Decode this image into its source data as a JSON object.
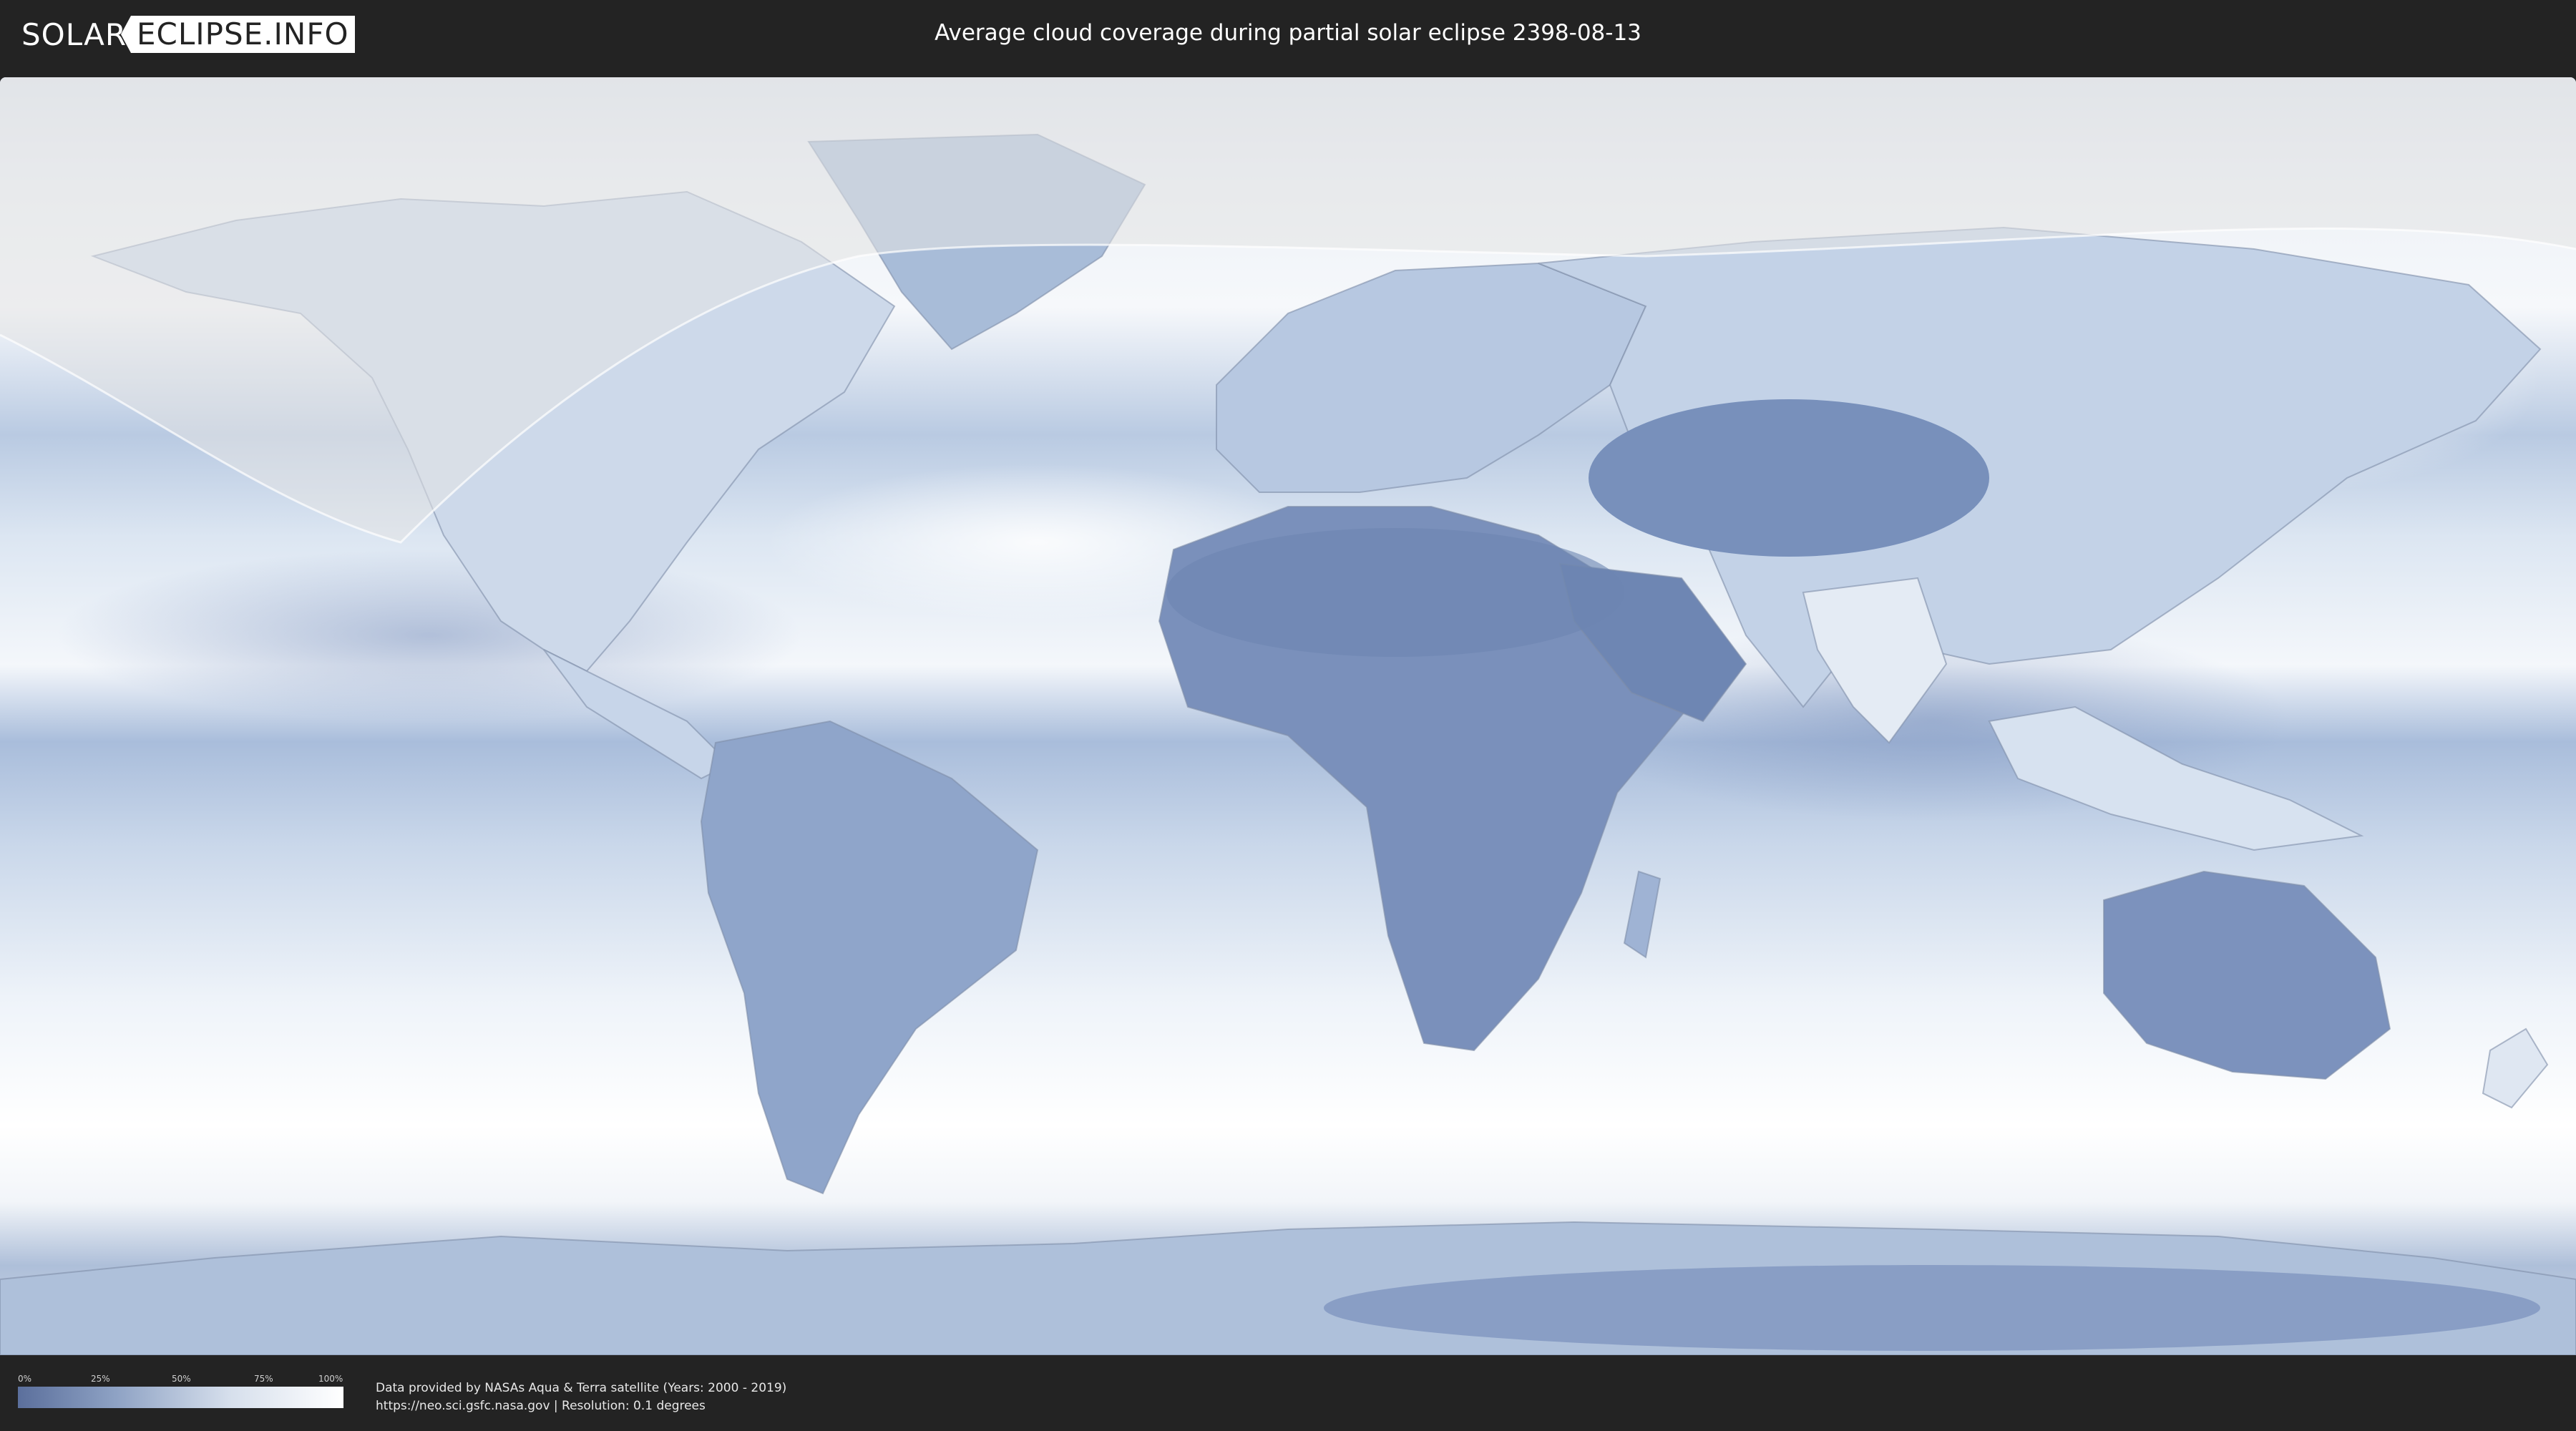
{
  "header": {
    "logo_solar": "SOLAR",
    "logo_eclipse": "ECLIPSE.INFO",
    "title": "Average cloud coverage during partial solar eclipse 2398-08-13"
  },
  "map": {
    "ocean_color": "#a3b8d6",
    "land_cloudy_color": "#e8eef6",
    "land_clear_color": "#6a82b0",
    "eclipse_visibility_overlay": "#e6e6e6"
  },
  "legend": {
    "ticks": [
      "0%",
      "25%",
      "50%",
      "75%",
      "100%"
    ],
    "color_min": "#5b6f9c",
    "color_max": "#ffffff"
  },
  "footer": {
    "credit_line1": "Data provided by NASAs Aqua & Terra satellite (Years: 2000 - 2019)",
    "credit_line2": "https://neo.sci.gsfc.nasa.gov | Resolution: 0.1 degrees"
  }
}
